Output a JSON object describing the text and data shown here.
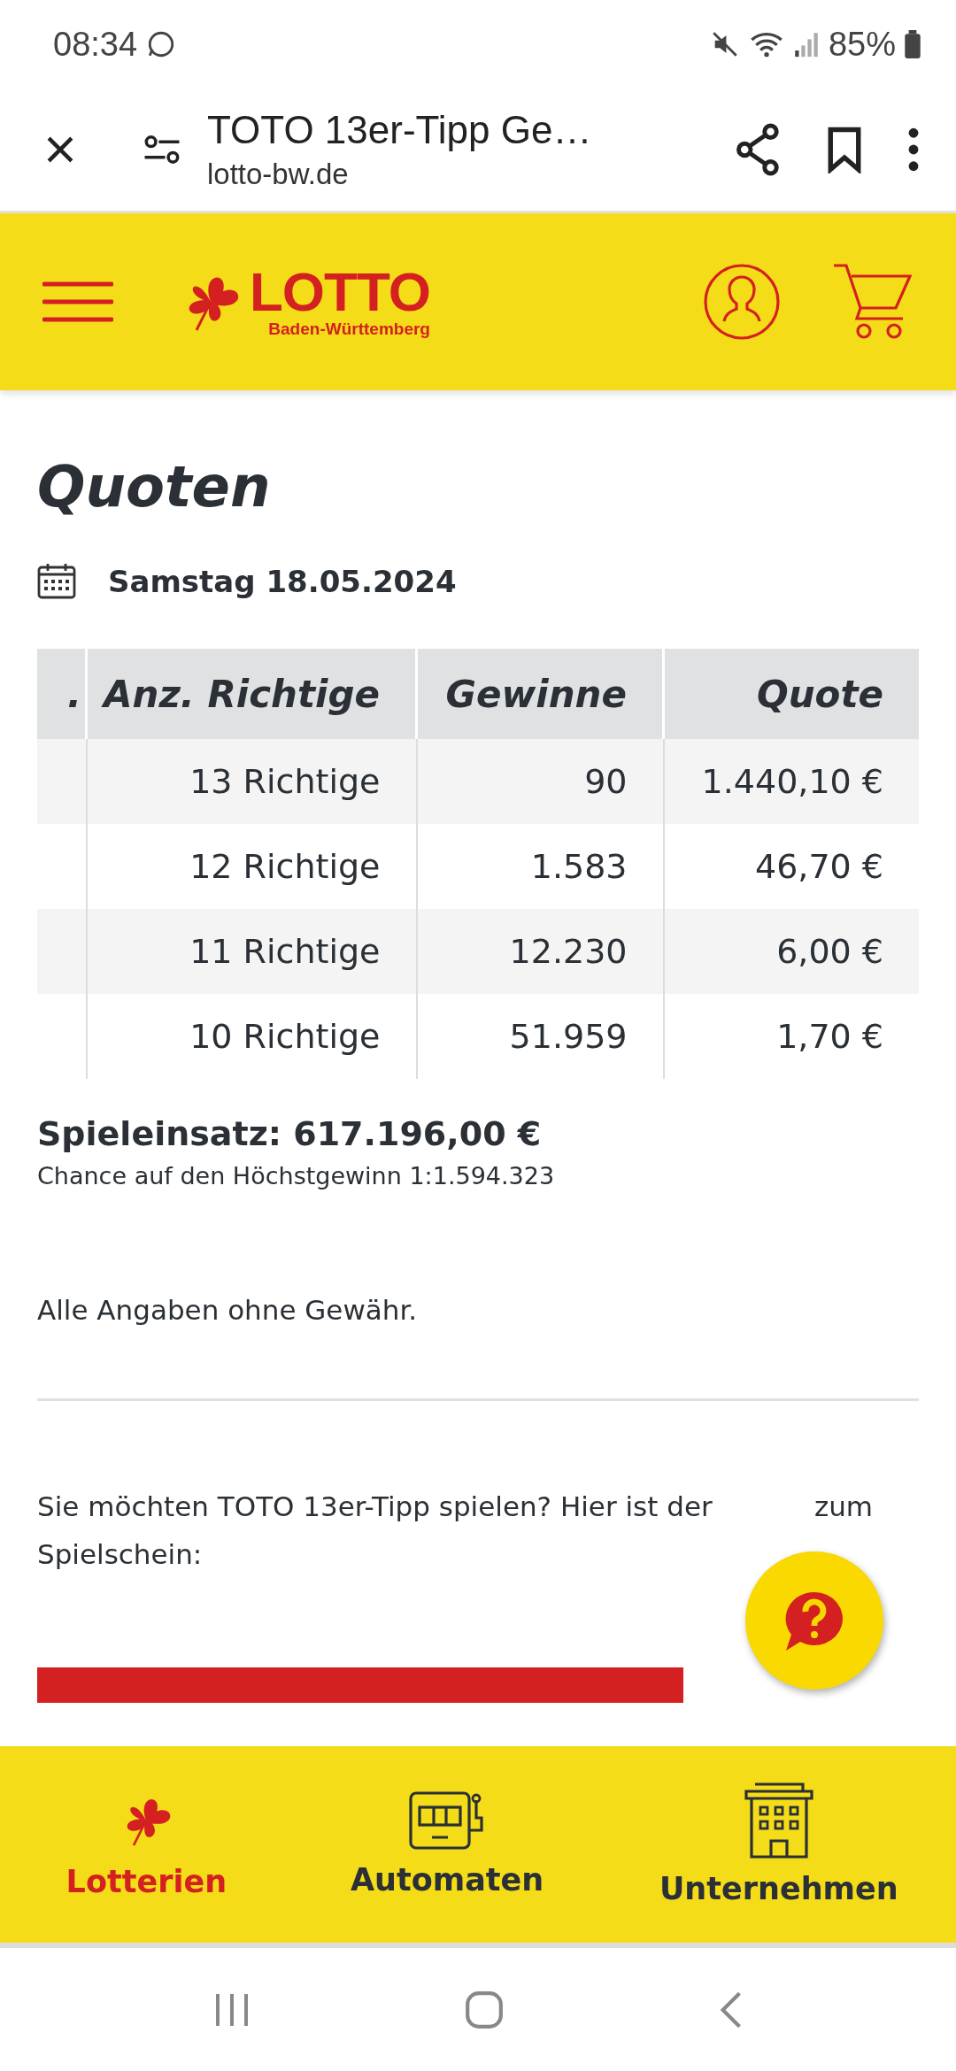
{
  "status_bar": {
    "time": "08:34",
    "battery": "85%"
  },
  "browser": {
    "title": "TOTO 13er-Tipp Ge…",
    "url": "lotto-bw.de"
  },
  "header": {
    "logo": "LOTTO",
    "logo_sub": "Baden-Württemberg"
  },
  "page_title": "Quoten",
  "date": "Samstag 18.05.2024",
  "table": {
    "columns": [
      ".",
      "Anz. Richtige",
      "Gewinne",
      "Quote"
    ],
    "rows": [
      [
        "",
        "13 Richtige",
        "90",
        "1.440,10 €"
      ],
      [
        "",
        "12 Richtige",
        "1.583",
        "46,70 €"
      ],
      [
        "",
        "11 Richtige",
        "12.230",
        "6,00 €"
      ],
      [
        "",
        "10 Richtige",
        "51.959",
        "1,70 €"
      ]
    ]
  },
  "stake": "Spieleinsatz: 617.196,00 €",
  "chance": "Chance auf den Höchstgewinn 1:1.594.323",
  "disclaimer": "Alle Angaben ohne Gewähr.",
  "play_text": [
    "Sie möchten TOTO 13er-Tipp spielen? Hier ist der",
    "zum",
    "Spielschein:"
  ],
  "bottom_nav": [
    {
      "label": "Lotterien",
      "kind": "clover",
      "selected": true
    },
    {
      "label": "Automaten",
      "kind": "machine",
      "selected": false
    },
    {
      "label": "Unternehmen",
      "kind": "building",
      "selected": false
    }
  ]
}
